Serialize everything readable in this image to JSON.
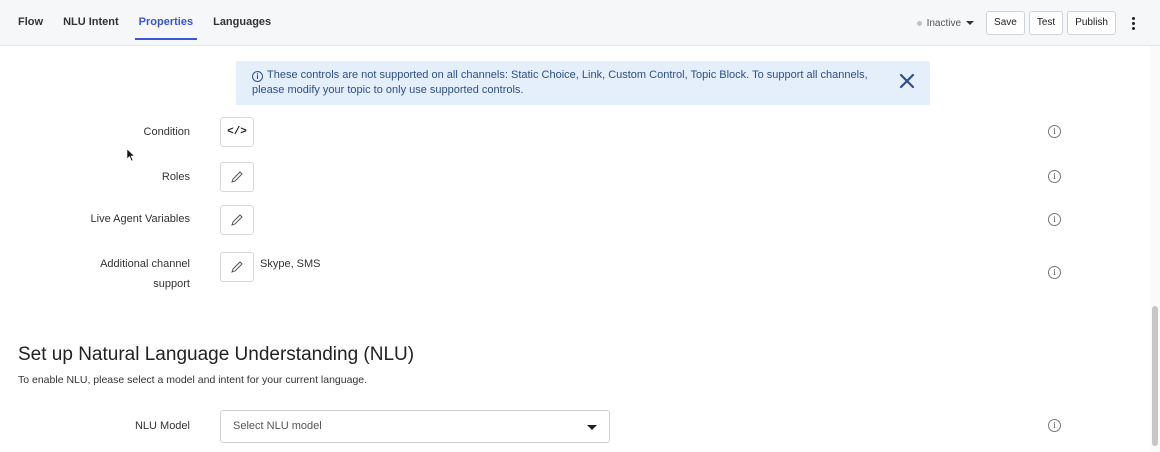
{
  "tabs": [
    {
      "label": "Flow",
      "active": false
    },
    {
      "label": "NLU Intent",
      "active": false
    },
    {
      "label": "Properties",
      "active": true
    },
    {
      "label": "Languages",
      "active": false
    }
  ],
  "toolbar": {
    "status_label": "Inactive",
    "save_label": "Save",
    "test_label": "Test",
    "publish_label": "Publish"
  },
  "banner": {
    "message": "These controls are not supported on all channels: Static Choice, Link, Custom Control, Topic Block. To support all channels, please modify your topic to only use supported controls."
  },
  "properties": [
    {
      "label": "Condition",
      "control_icon": "code-icon",
      "value": ""
    },
    {
      "label": "Roles",
      "control_icon": "pencil-icon",
      "value": ""
    },
    {
      "label": "Live Agent Variables",
      "control_icon": "pencil-icon",
      "value": ""
    },
    {
      "label_line1": "Additional channel",
      "label_line2": "support",
      "control_icon": "pencil-icon",
      "value": "Skype, SMS"
    }
  ],
  "nlu": {
    "title": "Set up Natural Language Understanding (NLU)",
    "subtitle": "To enable NLU, please select a model and intent for your current language.",
    "model_label": "NLU Model",
    "model_placeholder": "Select NLU model"
  },
  "colors": {
    "accent": "#3a55d6",
    "banner_bg": "#e5eefb",
    "banner_text": "#2c4f8a"
  }
}
